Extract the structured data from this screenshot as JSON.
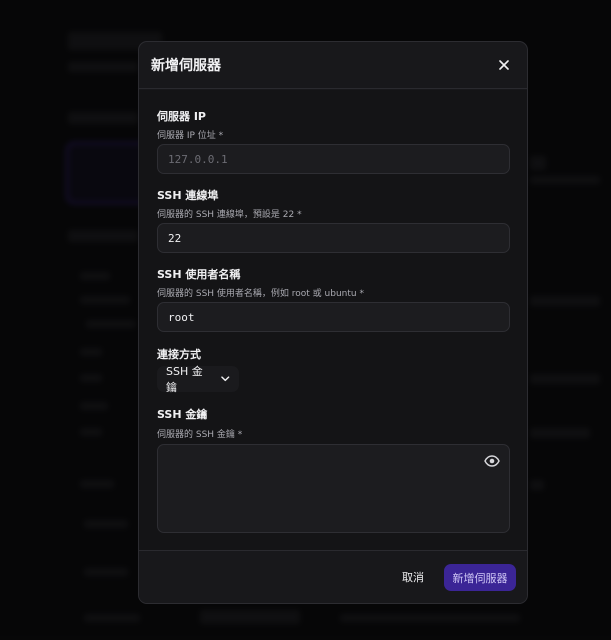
{
  "modal": {
    "title": "新增伺服器",
    "close_icon": "close-icon"
  },
  "fields": {
    "ip": {
      "label": "伺服器 IP",
      "description": "伺服器 IP 位址 *",
      "placeholder": "127.0.0.1",
      "value": ""
    },
    "port": {
      "label": "SSH 連線埠",
      "description": "伺服器的 SSH 連線埠，預設是 22 *",
      "value": "22"
    },
    "username": {
      "label": "SSH 使用者名稱",
      "description": "伺服器的 SSH 使用者名稱，例如 root 或 ubuntu *",
      "value": "root"
    },
    "method": {
      "label": "連接方式",
      "selected": "SSH 金鑰",
      "icon": "chevron-down-icon"
    },
    "ssh_key": {
      "label": "SSH 金鑰",
      "description": "伺服器的 SSH 金鑰 *",
      "value": "",
      "icon": "eye-icon"
    }
  },
  "footer": {
    "cancel_label": "取消",
    "submit_label": "新增伺服器"
  },
  "colors": {
    "accent": "#3b2596",
    "modal_bg": "#18181b",
    "page_bg": "#0c0c0e"
  }
}
